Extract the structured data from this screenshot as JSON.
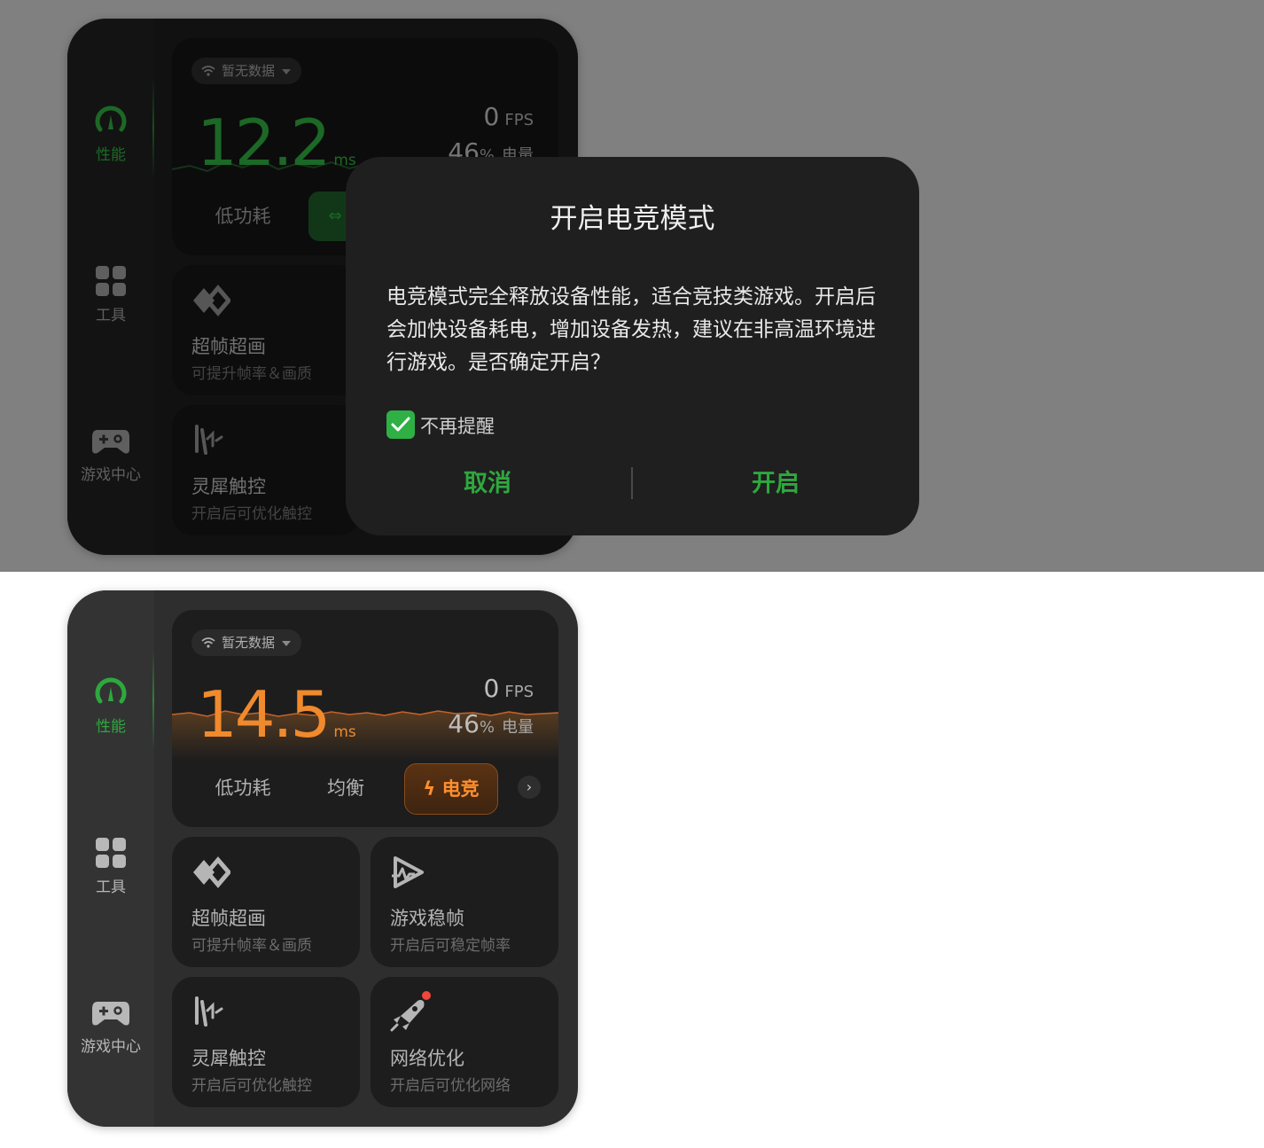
{
  "nav": {
    "performance": "性能",
    "tools": "工具",
    "game_center": "游戏中心"
  },
  "monitor_top": {
    "network": "暂无数据",
    "latency": "12.2",
    "latency_unit": "ms",
    "fps": "0",
    "fps_unit": "FPS",
    "battery": "46",
    "battery_pct": "%",
    "battery_unit": "电量",
    "mode_low": "低功耗"
  },
  "monitor_bottom": {
    "network": "暂无数据",
    "latency": "14.5",
    "latency_unit": "ms",
    "fps": "0",
    "fps_unit": "FPS",
    "battery": "46",
    "battery_pct": "%",
    "battery_unit": "电量",
    "modes": {
      "low": "低功耗",
      "balanced": "均衡",
      "esports": "电竞"
    }
  },
  "cards": {
    "super_frame": {
      "title": "超帧超画",
      "sub": "可提升帧率＆画质"
    },
    "stable_frame": {
      "title": "游戏稳帧",
      "sub": "开启后可稳定帧率"
    },
    "touch": {
      "title": "灵犀触控",
      "sub": "开启后可优化触控"
    },
    "network": {
      "title": "网络优化",
      "sub": "开启后可优化网络"
    }
  },
  "dialog": {
    "title": "开启电竞模式",
    "body": "电竞模式完全释放设备性能，适合竞技类游戏。开启后会加快设备耗电，增加设备发热，建议在非高温环境进行游戏。是否确定开启？",
    "checkbox_label": "不再提醒",
    "checkbox_checked": true,
    "cancel": "取消",
    "confirm": "开启"
  },
  "colors": {
    "accent_green": "#2ea83e",
    "accent_orange": "#f08a2c",
    "badge_red": "#f0463c"
  }
}
